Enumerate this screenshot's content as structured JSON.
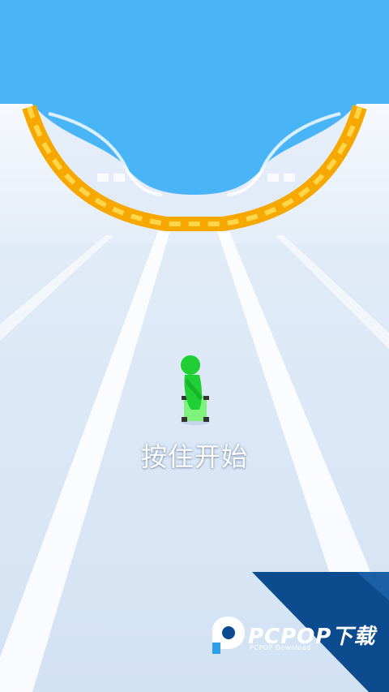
{
  "scene": {
    "sky_color": "#49b5f7",
    "track_color": "#dbe8f6",
    "rail_color": "#f6a800",
    "player_color": "#1fcf34"
  },
  "hud": {
    "prompt": "按住开始"
  },
  "watermark": {
    "logo": "pcpop-logo",
    "brand": "PCPOP下载",
    "sub": "PCPOP Download",
    "banner_color": "#0c4c8e"
  }
}
